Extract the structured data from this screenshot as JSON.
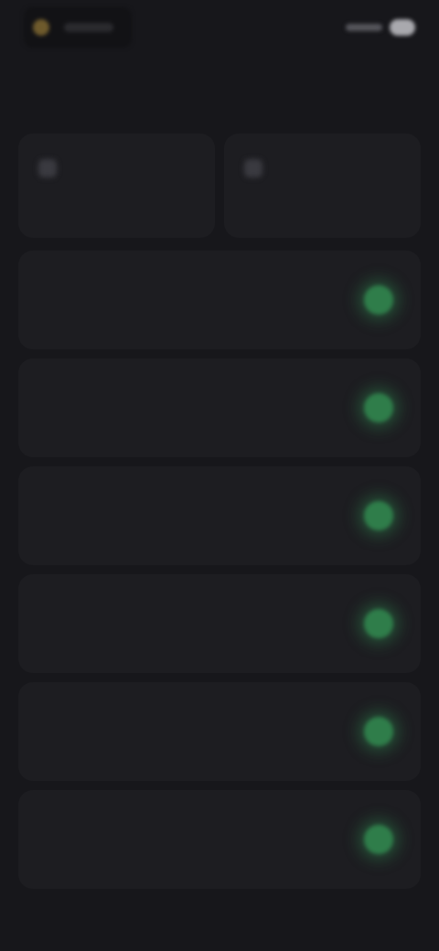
{
  "status_bar": {
    "time": "",
    "battery_icon": "battery-icon",
    "signal_icon": "signal-icon"
  },
  "header": {
    "title": ""
  },
  "cards": [
    {
      "icon": "card-icon",
      "label": ""
    },
    {
      "icon": "card-icon",
      "label": ""
    }
  ],
  "settings": [
    {
      "label": "",
      "enabled": true
    },
    {
      "label": "",
      "enabled": true
    },
    {
      "label": "",
      "enabled": true
    },
    {
      "label": "",
      "enabled": true
    },
    {
      "label": "",
      "enabled": true
    },
    {
      "label": "",
      "enabled": true
    }
  ],
  "colors": {
    "background": "#17171b",
    "card": "#1d1d21",
    "toggle_on": "#2f7d4a"
  }
}
